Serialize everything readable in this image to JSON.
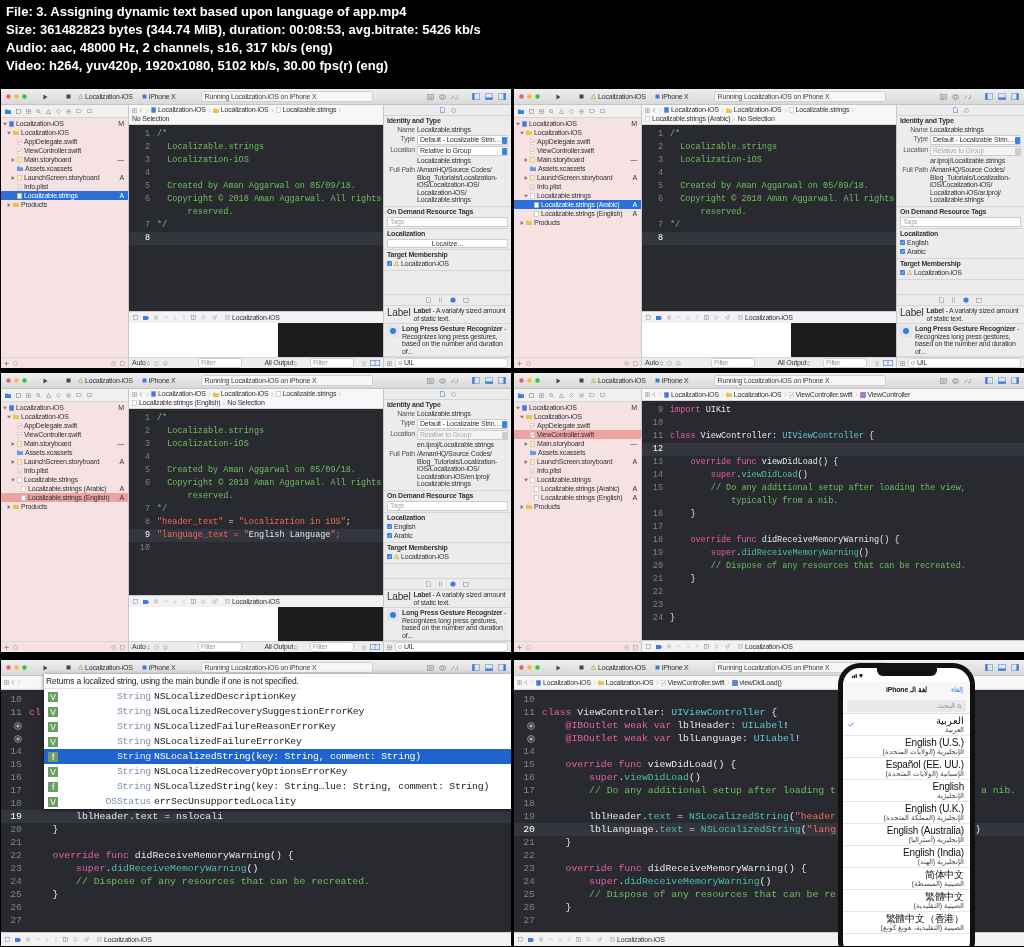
{
  "header": {
    "lines": [
      "File: 3. Assigning dynamic text based upon language of app.mp4",
      "Size: 361482823 bytes (344.74 MiB), duration: 00:08:53, avg.bitrate: 5426 kb/s",
      "Audio: aac, 48000 Hz, 2 channels, s16, 317 kb/s (eng)",
      "Video: h264, yuv420p, 1920x1080, 5102 kb/s, 30.00 fps(r) (eng)"
    ]
  },
  "frames": [
    {
      "kind": "ide",
      "toolbar": {
        "scheme": "Localization-iOS",
        "device": "iPhone X",
        "status": "Running Localization-iOS on iPhone X"
      },
      "navigator": {
        "focused": true,
        "items": [
          {
            "label": "Localization-iOS",
            "kind": "project",
            "badge": "M",
            "selected": false,
            "expanded": true,
            "children": [
              {
                "label": "Localization-iOS",
                "kind": "folder",
                "selected": false,
                "expanded": true,
                "children": [
                  {
                    "label": "AppDelegate.swift",
                    "kind": "swift",
                    "selected": false
                  },
                  {
                    "label": "ViewController.swift",
                    "kind": "swift",
                    "selected": false
                  },
                  {
                    "label": "Main.storyboard",
                    "kind": "storyboard",
                    "badge": "—",
                    "selected": false,
                    "expanded": false
                  },
                  {
                    "label": "Assets.xcassets",
                    "kind": "assets",
                    "selected": false
                  },
                  {
                    "label": "LaunchScreen.storyboard",
                    "kind": "storyboard",
                    "badge": "A",
                    "selected": false,
                    "expanded": false
                  },
                  {
                    "label": "Info.plist",
                    "kind": "plist",
                    "selected": false
                  },
                  {
                    "label": "Localizable.strings",
                    "kind": "strings",
                    "badge": "A",
                    "selected": true
                  }
                ]
              },
              {
                "label": "Products",
                "kind": "folder",
                "selected": false,
                "expanded": false
              }
            ]
          }
        ]
      },
      "breadcrumb": [
        {
          "label": "Localization-iOS",
          "kind": "project"
        },
        {
          "label": "Localization-iOS",
          "kind": "folder"
        },
        {
          "label": "Localizable.strings",
          "kind": "strings"
        },
        {
          "label": "No Selection",
          "kind": "text"
        }
      ],
      "code": [
        {
          "number": "1",
          "tokens": [
            {
              "kind": "comment",
              "text": "/*"
            }
          ]
        },
        {
          "number": "2",
          "tokens": [
            {
              "kind": "comment",
              "text": "  Localizable.strings"
            }
          ]
        },
        {
          "number": "3",
          "tokens": [
            {
              "kind": "comment",
              "text": "  Localization-iOS"
            }
          ]
        },
        {
          "number": "4"
        },
        {
          "number": "5",
          "tokens": [
            {
              "kind": "comment",
              "text": "  Created by Aman Aggarwal on 05/09/18."
            }
          ]
        },
        {
          "number": "6",
          "tokens": [
            {
              "kind": "comment",
              "text": "  Copyright © 2018 Aman Aggarwal. All rights"
            }
          ]
        },
        {
          "tokens": [
            {
              "kind": "comment",
              "text": "      reserved."
            }
          ]
        },
        {
          "number": "7",
          "tokens": [
            {
              "kind": "comment",
              "text": "*/"
            }
          ]
        },
        {
          "number": "8",
          "current": true
        }
      ],
      "debug": {
        "target": "Localization-iOS",
        "console": {
          "mode": "Auto",
          "filter_placeholder": "Filter",
          "output": "All Output",
          "output_filter_placeholder": "Filter"
        }
      },
      "inspector": {
        "identity": {
          "heading": "Identity and Type",
          "rows": [
            {
              "label": "Name",
              "value": "Localizable.strings",
              "kind": "text"
            },
            {
              "label": "Type",
              "value": "Default - Localizable Strin…",
              "kind": "popup",
              "disabled": false
            },
            {
              "label": "Location",
              "value": "Relative to Group",
              "kind": "popup",
              "disabled": false
            }
          ],
          "file": "Localizable.strings",
          "path_label": "Full Path",
          "path": [
            "/AmanHQ/Source Codes/",
            "Blog_Tutorials/Localization-",
            "iOS/Localization-iOS/",
            "Localization-iOS/",
            "Localizable.strings"
          ]
        },
        "tags": {
          "heading": "On Demand Resource Tags",
          "placeholder": "Tags"
        },
        "localization": {
          "heading": "Localization",
          "button": "Localize..."
        },
        "target": {
          "heading": "Target Membership",
          "items": [
            {
              "label": "Localization-iOS",
              "checked": true
            }
          ]
        },
        "library": [
          {
            "kind": "sample",
            "sample": "Label",
            "text": "**Label** - A variably sized amount of static text."
          },
          {
            "kind": "gesture",
            "text": "**Long Press Gesture Recognizer** - Recognizes long press gestures, based on the number and duration of..."
          }
        ],
        "filter": "UIL"
      }
    },
    {
      "kind": "ide",
      "toolbar": {
        "scheme": "Localization-iOS",
        "device": "iPhone X",
        "status": "Running Localization-iOS on iPhone X"
      },
      "navigator": {
        "focused": true,
        "items": [
          {
            "label": "Localization-iOS",
            "kind": "project",
            "badge": "M",
            "selected": false,
            "expanded": true,
            "children": [
              {
                "label": "Localization-iOS",
                "kind": "folder",
                "selected": false,
                "expanded": true,
                "children": [
                  {
                    "label": "AppDelegate.swift",
                    "kind": "swift",
                    "selected": false
                  },
                  {
                    "label": "ViewController.swift",
                    "kind": "swift",
                    "selected": false
                  },
                  {
                    "label": "Main.storyboard",
                    "kind": "storyboard",
                    "badge": "—",
                    "selected": false,
                    "expanded": false
                  },
                  {
                    "label": "Assets.xcassets",
                    "kind": "assets",
                    "selected": false
                  },
                  {
                    "label": "LaunchScreen.storyboard",
                    "kind": "storyboard",
                    "badge": "A",
                    "selected": false,
                    "expanded": false
                  },
                  {
                    "label": "Info.plist",
                    "kind": "plist",
                    "selected": false
                  },
                  {
                    "label": "Localizable.strings",
                    "kind": "strings",
                    "selected": false,
                    "expanded": true,
                    "children": [
                      {
                        "label": "Localizable.strings (Arabic)",
                        "kind": "strings",
                        "badge": "A",
                        "selected": true
                      },
                      {
                        "label": "Localizable.strings (English)",
                        "kind": "strings",
                        "badge": "A",
                        "selected": false
                      }
                    ]
                  }
                ]
              },
              {
                "label": "Products",
                "kind": "folder",
                "selected": false,
                "expanded": false
              }
            ]
          }
        ]
      },
      "breadcrumb": [
        {
          "label": "Localization-iOS",
          "kind": "project"
        },
        {
          "label": "Localization-iOS",
          "kind": "folder"
        },
        {
          "label": "Localizable.strings",
          "kind": "strings"
        },
        {
          "label": "Localizable.strings (Arabic)",
          "kind": "strings"
        },
        {
          "label": "No Selection",
          "kind": "text"
        }
      ],
      "code": [
        {
          "number": "1",
          "tokens": [
            {
              "kind": "comment",
              "text": "/*"
            }
          ]
        },
        {
          "number": "2",
          "tokens": [
            {
              "kind": "comment",
              "text": "  Localizable.strings"
            }
          ]
        },
        {
          "number": "3",
          "tokens": [
            {
              "kind": "comment",
              "text": "  Localization-iOS"
            }
          ]
        },
        {
          "number": "4"
        },
        {
          "number": "5",
          "tokens": [
            {
              "kind": "comment",
              "text": "  Created by Aman Aggarwal on 05/09/18."
            }
          ]
        },
        {
          "number": "6",
          "tokens": [
            {
              "kind": "comment",
              "text": "  Copyright © 2018 Aman Aggarwal. All rights"
            }
          ]
        },
        {
          "tokens": [
            {
              "kind": "comment",
              "text": "      reserved."
            }
          ]
        },
        {
          "number": "7",
          "tokens": [
            {
              "kind": "comment",
              "text": "*/"
            }
          ]
        },
        {
          "number": "8",
          "current": true
        }
      ],
      "debug": {
        "target": "Localization-iOS",
        "console": {
          "mode": "Auto",
          "filter_placeholder": "Filter",
          "output": "All Output",
          "output_filter_placeholder": "Filter"
        }
      },
      "inspector": {
        "identity": {
          "heading": "Identity and Type",
          "rows": [
            {
              "label": "Name",
              "value": "Localizable.strings",
              "kind": "text"
            },
            {
              "label": "Type",
              "value": "Default - Localizable Strin…",
              "kind": "popup",
              "disabled": false
            },
            {
              "label": "Location",
              "value": "Relative to Group",
              "kind": "popup",
              "disabled": true
            }
          ],
          "file": "ar.lproj/Localizable.strings",
          "path_label": "Full Path",
          "path": [
            "/AmanHQ/Source Codes/",
            "Blog_Tutorials/Localization-",
            "iOS/Localization-iOS/",
            "Localization-iOS/ar.lproj/",
            "Localizable.strings"
          ]
        },
        "tags": {
          "heading": "On Demand Resource Tags",
          "placeholder": "Tags"
        },
        "localization": {
          "heading": "Localization",
          "languages": [
            {
              "label": "English",
              "checked": true
            },
            {
              "label": "Arabic",
              "checked": true
            }
          ]
        },
        "target": {
          "heading": "Target Membership",
          "items": [
            {
              "label": "Localization-iOS",
              "checked": true
            }
          ]
        },
        "library": [
          {
            "kind": "sample",
            "sample": "Label",
            "text": "**Label** - A variably sized amount of static text."
          },
          {
            "kind": "gesture",
            "text": "**Long Press Gesture Recognizer** - Recognizes long press gestures, based on the number and duration of..."
          }
        ],
        "filter": "UIL"
      }
    },
    {
      "kind": "ide",
      "toolbar": {
        "scheme": "Localization-iOS",
        "device": "iPhone X",
        "status": "Running Localization-iOS on iPhone X"
      },
      "navigator": {
        "focused": false,
        "items": [
          {
            "label": "Localization-iOS",
            "kind": "project",
            "badge": "M",
            "selected": false,
            "expanded": true,
            "children": [
              {
                "label": "Localization-iOS",
                "kind": "folder",
                "selected": false,
                "expanded": true,
                "children": [
                  {
                    "label": "AppDelegate.swift",
                    "kind": "swift",
                    "selected": false
                  },
                  {
                    "label": "ViewController.swift",
                    "kind": "swift",
                    "selected": false
                  },
                  {
                    "label": "Main.storyboard",
                    "kind": "storyboard",
                    "badge": "—",
                    "selected": false,
                    "expanded": false
                  },
                  {
                    "label": "Assets.xcassets",
                    "kind": "assets",
                    "selected": false
                  },
                  {
                    "label": "LaunchScreen.storyboard",
                    "kind": "storyboard",
                    "badge": "A",
                    "selected": false,
                    "expanded": false
                  },
                  {
                    "label": "Info.plist",
                    "kind": "plist",
                    "selected": false
                  },
                  {
                    "label": "Localizable.strings",
                    "kind": "strings",
                    "selected": false,
                    "expanded": true,
                    "children": [
                      {
                        "label": "Localizable.strings (Arabic)",
                        "kind": "strings",
                        "badge": "A",
                        "selected": false
                      },
                      {
                        "label": "Localizable.strings (English)",
                        "kind": "strings",
                        "badge": "A",
                        "selected": true
                      }
                    ]
                  }
                ]
              },
              {
                "label": "Products",
                "kind": "folder",
                "selected": false,
                "expanded": false
              }
            ]
          }
        ]
      },
      "breadcrumb": [
        {
          "label": "Localization-iOS",
          "kind": "project"
        },
        {
          "label": "Localization-iOS",
          "kind": "folder"
        },
        {
          "label": "Localizable.strings",
          "kind": "strings"
        },
        {
          "label": "Localizable.strings (English)",
          "kind": "strings"
        },
        {
          "label": "No Selection",
          "kind": "text"
        }
      ],
      "code": [
        {
          "number": "1",
          "tokens": [
            {
              "kind": "comment",
              "text": "/*"
            }
          ]
        },
        {
          "number": "2",
          "tokens": [
            {
              "kind": "comment",
              "text": "  Localizable.strings"
            }
          ]
        },
        {
          "number": "3",
          "tokens": [
            {
              "kind": "comment",
              "text": "  Localization-iOS"
            }
          ]
        },
        {
          "number": "4"
        },
        {
          "number": "5",
          "tokens": [
            {
              "kind": "comment",
              "text": "  Created by Aman Aggarwal on 05/09/18."
            }
          ]
        },
        {
          "number": "6",
          "tokens": [
            {
              "kind": "comment",
              "text": "  Copyright © 2018 Aman Aggarwal. All rights"
            }
          ]
        },
        {
          "tokens": [
            {
              "kind": "comment",
              "text": "      reserved."
            }
          ]
        },
        {
          "number": "7",
          "tokens": [
            {
              "kind": "comment",
              "text": "*/"
            }
          ]
        },
        {
          "number": "8",
          "tokens": [
            {
              "kind": "string",
              "text": "\"header_text\""
            },
            {
              "kind": "plain",
              "text": " = "
            },
            {
              "kind": "string",
              "text": "\"Localization in iOS\""
            },
            {
              "kind": "plain",
              "text": ";"
            }
          ]
        },
        {
          "number": "9",
          "tokens": [
            {
              "kind": "string",
              "text": "\"language_text = \""
            },
            {
              "kind": "plain",
              "text": "English Language"
            },
            {
              "kind": "string",
              "text": "\";"
            }
          ],
          "current": true
        },
        {
          "number": "10"
        }
      ],
      "debug": {
        "target": "Localization-iOS",
        "console": {
          "mode": "Auto",
          "filter_placeholder": "Filter",
          "output": "All Output",
          "output_filter_placeholder": "Filter"
        }
      },
      "inspector": {
        "identity": {
          "heading": "Identity and Type",
          "rows": [
            {
              "label": "Name",
              "value": "Localizable.strings",
              "kind": "text"
            },
            {
              "label": "Type",
              "value": "Default - Localizable Strin…",
              "kind": "popup",
              "disabled": false
            },
            {
              "label": "Location",
              "value": "Relative to Group",
              "kind": "popup",
              "disabled": true
            }
          ],
          "file": "en.lproj/Localizable.strings",
          "path_label": "Full Path",
          "path": [
            "/AmanHQ/Source Codes/",
            "Blog_Tutorials/Localization-",
            "iOS/Localization-iOS/",
            "Localization-iOS/en.lproj/",
            "Localizable.strings"
          ]
        },
        "tags": {
          "heading": "On Demand Resource Tags",
          "placeholder": "Tags"
        },
        "localization": {
          "heading": "Localization",
          "languages": [
            {
              "label": "English",
              "checked": true
            },
            {
              "label": "Arabic",
              "checked": true
            }
          ]
        },
        "target": {
          "heading": "Target Membership",
          "items": [
            {
              "label": "Localization-iOS",
              "checked": true
            }
          ]
        },
        "library": [
          {
            "kind": "sample",
            "sample": "Label",
            "text": "**Label** - A variably sized amount of static text."
          },
          {
            "kind": "gesture",
            "text": "**Long Press Gesture Recognizer** - Recognizes long press gestures, based on the number and duration of..."
          }
        ],
        "filter": "UIL"
      }
    },
    {
      "kind": "ide",
      "toolbar": {
        "scheme": "Localization-iOS",
        "device": "iPhone X",
        "status": "Running Localization-iOS on iPhone X"
      },
      "navigator": {
        "focused": false,
        "items": [
          {
            "label": "Localization-iOS",
            "kind": "project",
            "badge": "M",
            "selected": false,
            "expanded": true,
            "children": [
              {
                "label": "Localization-iOS",
                "kind": "folder",
                "selected": false,
                "expanded": true,
                "children": [
                  {
                    "label": "AppDelegate.swift",
                    "kind": "swift",
                    "selected": false
                  },
                  {
                    "label": "ViewController.swift",
                    "kind": "swift",
                    "selected": true
                  },
                  {
                    "label": "Main.storyboard",
                    "kind": "storyboard",
                    "badge": "—",
                    "selected": false,
                    "expanded": false
                  },
                  {
                    "label": "Assets.xcassets",
                    "kind": "assets",
                    "selected": false
                  },
                  {
                    "label": "LaunchScreen.storyboard",
                    "kind": "storyboard",
                    "badge": "A",
                    "selected": false,
                    "expanded": false
                  },
                  {
                    "label": "Info.plist",
                    "kind": "plist",
                    "selected": false
                  },
                  {
                    "label": "Localizable.strings",
                    "kind": "strings",
                    "selected": false,
                    "expanded": true,
                    "children": [
                      {
                        "label": "Localizable.strings (Arabic)",
                        "kind": "strings",
                        "badge": "A",
                        "selected": false
                      },
                      {
                        "label": "Localizable.strings (English)",
                        "kind": "strings",
                        "badge": "A",
                        "selected": false
                      }
                    ]
                  }
                ]
              },
              {
                "label": "Products",
                "kind": "folder",
                "selected": false,
                "expanded": false
              }
            ]
          }
        ]
      },
      "breadcrumb": [
        {
          "label": "Localization-iOS",
          "kind": "project"
        },
        {
          "label": "Localization-iOS",
          "kind": "folder"
        },
        {
          "label": "ViewController.swift",
          "kind": "swift"
        },
        {
          "label": "ViewController",
          "kind": "class"
        }
      ],
      "code": [
        {
          "number": "9",
          "tokens": [
            {
              "kind": "keyword",
              "text": "import"
            },
            {
              "kind": "plain",
              "text": " UIKit"
            }
          ]
        },
        {
          "number": "10"
        },
        {
          "number": "11",
          "tokens": [
            {
              "kind": "keyword",
              "text": "class"
            },
            {
              "kind": "plain",
              "text": " ViewController: "
            },
            {
              "kind": "type",
              "text": "UIViewController"
            },
            {
              "kind": "plain",
              "text": " {"
            }
          ]
        },
        {
          "number": "12",
          "current": true
        },
        {
          "number": "13",
          "tokens": [
            {
              "kind": "keyword",
              "text": "    override func"
            },
            {
              "kind": "plain",
              "text": " viewDidLoad() {"
            }
          ]
        },
        {
          "number": "14",
          "tokens": [
            {
              "kind": "keyword",
              "text": "        super"
            },
            {
              "kind": "plain",
              "text": "."
            },
            {
              "kind": "call",
              "text": "viewDidLoad"
            },
            {
              "kind": "plain",
              "text": "()"
            }
          ]
        },
        {
          "number": "15",
          "tokens": [
            {
              "kind": "comment",
              "text": "        // Do any additional setup after loading the view,"
            }
          ]
        },
        {
          "tokens": [
            {
              "kind": "comment",
              "text": "            typically from a nib."
            }
          ]
        },
        {
          "number": "16",
          "tokens": [
            {
              "kind": "plain",
              "text": "    }"
            }
          ]
        },
        {
          "number": "17"
        },
        {
          "number": "18",
          "tokens": [
            {
              "kind": "keyword",
              "text": "    override func"
            },
            {
              "kind": "plain",
              "text": " didReceiveMemoryWarning() {"
            }
          ]
        },
        {
          "number": "19",
          "tokens": [
            {
              "kind": "keyword",
              "text": "        super"
            },
            {
              "kind": "plain",
              "text": "."
            },
            {
              "kind": "call",
              "text": "didReceiveMemoryWarning"
            },
            {
              "kind": "plain",
              "text": "()"
            }
          ]
        },
        {
          "number": "20",
          "tokens": [
            {
              "kind": "comment",
              "text": "        // Dispose of any resources that can be recreated."
            }
          ]
        },
        {
          "number": "21",
          "tokens": [
            {
              "kind": "plain",
              "text": "    }"
            }
          ]
        },
        {
          "number": "22"
        },
        {
          "number": "23"
        },
        {
          "number": "24",
          "tokens": [
            {
              "kind": "plain",
              "text": "}"
            }
          ]
        }
      ],
      "debug": {
        "target": "Localization-iOS"
      }
    },
    {
      "kind": "zoomed",
      "toolbar": {
        "scheme": "Localization-iOS",
        "device": "iPhone X",
        "status": "Running Localization-iOS on iPhone X"
      },
      "code": [
        {
          "number": "10"
        },
        {
          "number": "11",
          "tokens": [
            {
              "kind": "keyword",
              "text": "cl"
            }
          ]
        },
        {
          "kind": "outlet"
        },
        {
          "kind": "outlet"
        },
        {
          "number": "14"
        },
        {
          "number": "15"
        },
        {
          "number": "16"
        },
        {
          "number": "17"
        },
        {
          "number": "18"
        },
        {
          "number": "19",
          "tokens": [
            {
              "kind": "plain",
              "text": "        lblHeader.text = nslocali"
            }
          ],
          "current": true
        },
        {
          "number": "20",
          "tokens": [
            {
              "kind": "plain",
              "text": "    }"
            }
          ]
        },
        {
          "number": "21"
        },
        {
          "number": "22",
          "tokens": [
            {
              "kind": "keyword",
              "text": "    override func"
            },
            {
              "kind": "plain",
              "text": " didReceiveMemoryWarning() {"
            }
          ]
        },
        {
          "number": "23",
          "tokens": [
            {
              "kind": "keyword",
              "text": "        super"
            },
            {
              "kind": "plain",
              "text": "."
            },
            {
              "kind": "call",
              "text": "didReceiveMemoryWarning"
            },
            {
              "kind": "plain",
              "text": "()"
            }
          ]
        },
        {
          "number": "24",
          "tokens": [
            {
              "kind": "comment",
              "text": "        // Dispose of any resources that can be recreated."
            }
          ]
        },
        {
          "number": "25",
          "tokens": [
            {
              "kind": "plain",
              "text": "    }"
            }
          ]
        },
        {
          "number": "26"
        },
        {
          "number": "27"
        }
      ],
      "debug": {
        "target": "Localization-iOS"
      },
      "popup": {
        "description": "Returns a localized string, using the main bundle if one is not specified.",
        "items": [
          {
            "badge": "V",
            "type": "String",
            "name": "NSLocalizedDescriptionKey",
            "selected": false
          },
          {
            "badge": "V",
            "type": "String",
            "name": "NSLocalizedRecoverySuggestionErrorKey",
            "selected": false
          },
          {
            "badge": "V",
            "type": "String",
            "name": "NSLocalizedFailureReasonErrorKey",
            "selected": false
          },
          {
            "badge": "V",
            "type": "String",
            "name": "NSLocalizedFailureErrorKey",
            "selected": false
          },
          {
            "badge": "f",
            "type": "String",
            "name": "NSLocalizedString(key: String, comment: String)",
            "selected": true
          },
          {
            "badge": "V",
            "type": "String",
            "name": "NSLocalizedRecoveryOptionsErrorKey",
            "selected": false
          },
          {
            "badge": "f",
            "type": "String",
            "name": "NSLocalizedString(key: String…lue: String, comment: String)",
            "selected": false
          },
          {
            "badge": "V",
            "type": "OSStatus",
            "name": "errSecUnsupportedLocality",
            "selected": false
          }
        ]
      }
    },
    {
      "kind": "zoomed",
      "toolbar": {
        "scheme": "Localization-iOS",
        "device": "iPhone X",
        "status": "Running Localization-iOS on iPhone X"
      },
      "breadcrumb": [
        {
          "label": "Localization-iOS",
          "kind": "project"
        },
        {
          "label": "Localization-iOS",
          "kind": "folder"
        },
        {
          "label": "ViewController.swift",
          "kind": "swift"
        },
        {
          "label": "viewDidLoad()",
          "kind": "method"
        }
      ],
      "code": [
        {
          "number": "10"
        },
        {
          "number": "11",
          "tokens": [
            {
              "kind": "keyword",
              "text": "class"
            },
            {
              "kind": "plain",
              "text": " ViewController: "
            },
            {
              "kind": "type",
              "text": "UIViewController"
            },
            {
              "kind": "plain",
              "text": " {"
            }
          ]
        },
        {
          "kind": "outlet",
          "tokens": [
            {
              "kind": "keyword",
              "text": "    @IBOutlet weak var"
            },
            {
              "kind": "plain",
              "text": " lblHeader: "
            },
            {
              "kind": "type",
              "text": "UILabel"
            },
            {
              "kind": "plain",
              "text": "!"
            }
          ]
        },
        {
          "kind": "outlet",
          "tokens": [
            {
              "kind": "keyword",
              "text": "    @IBOutlet weak var"
            },
            {
              "kind": "plain",
              "text": " lblLanguage: "
            },
            {
              "kind": "type",
              "text": "UILabel"
            },
            {
              "kind": "plain",
              "text": "!"
            }
          ]
        },
        {
          "number": "14"
        },
        {
          "number": "15",
          "tokens": [
            {
              "kind": "keyword",
              "text": "    override func"
            },
            {
              "kind": "plain",
              "text": " viewDidLoad() {"
            }
          ]
        },
        {
          "number": "16",
          "tokens": [
            {
              "kind": "keyword",
              "text": "        super"
            },
            {
              "kind": "plain",
              "text": "."
            },
            {
              "kind": "call",
              "text": "viewDidLoad"
            },
            {
              "kind": "plain",
              "text": "()"
            }
          ]
        },
        {
          "number": "17",
          "tokens": [
            {
              "kind": "comment",
              "text": "        // Do any additional setup after loading t"
            }
          ],
          "tail": [
            {
              "kind": "comment",
              "text": " a nib."
            }
          ]
        },
        {
          "number": "18"
        },
        {
          "number": "19",
          "tokens": [
            {
              "kind": "plain",
              "text": "        lblHeader."
            },
            {
              "kind": "call",
              "text": "text"
            },
            {
              "kind": "plain",
              "text": " = "
            },
            {
              "kind": "call",
              "text": "NSLocalizedString"
            },
            {
              "kind": "plain",
              "text": "("
            },
            {
              "kind": "string",
              "text": "\"header"
            }
          ]
        },
        {
          "number": "20",
          "tokens": [
            {
              "kind": "plain",
              "text": "        lblLanguage."
            },
            {
              "kind": "call",
              "text": "text"
            },
            {
              "kind": "plain",
              "text": " = "
            },
            {
              "kind": "call",
              "text": "NSLocalizedString"
            },
            {
              "kind": "plain",
              "text": "("
            },
            {
              "kind": "string",
              "text": "\"lang"
            }
          ],
          "tail": [
            {
              "kind": "plain",
              "text": ")"
            }
          ],
          "current": true
        },
        {
          "number": "21",
          "tokens": [
            {
              "kind": "plain",
              "text": "    }"
            }
          ]
        },
        {
          "number": "22"
        },
        {
          "number": "23",
          "tokens": [
            {
              "kind": "keyword",
              "text": "    override func"
            },
            {
              "kind": "plain",
              "text": " didReceiveMemoryWarning() {"
            }
          ]
        },
        {
          "number": "24",
          "tokens": [
            {
              "kind": "keyword",
              "text": "        super"
            },
            {
              "kind": "plain",
              "text": "."
            },
            {
              "kind": "call",
              "text": "didReceiveMemoryWarning"
            },
            {
              "kind": "plain",
              "text": "()"
            }
          ]
        },
        {
          "number": "25",
          "tokens": [
            {
              "kind": "comment",
              "text": "        // Dispose of any resources that can be re"
            }
          ]
        },
        {
          "number": "26",
          "tokens": [
            {
              "kind": "plain",
              "text": "    }"
            }
          ]
        },
        {
          "number": "27"
        }
      ],
      "debug": {
        "target": "Localization-iOS"
      },
      "phone": {
        "title": "لغة الـ iPhone",
        "cancel": "إلغاء",
        "search_placeholder": "البحث",
        "languages": [
          {
            "name": "العربية",
            "native": "العربية",
            "selected": true
          },
          {
            "name": "English (U.S.)",
            "native": "الإنجليزية (الولايات المتحدة)",
            "selected": false
          },
          {
            "name": "Español (EE. UU.)",
            "native": "الإسبانية (الولايات المتحدة)",
            "selected": false
          },
          {
            "name": "English",
            "native": "الإنجليزية",
            "selected": false
          },
          {
            "name": "English (U.K.)",
            "native": "الإنجليزية (المملكة المتحدة)",
            "selected": false
          },
          {
            "name": "English (Australia)",
            "native": "الإنجليزية (أستراليا)",
            "selected": false
          },
          {
            "name": "English (India)",
            "native": "الإنجليزية (الهند)",
            "selected": false
          },
          {
            "name": "简体中文",
            "native": "الصينية (المبسطة)",
            "selected": false
          },
          {
            "name": "繁體中文",
            "native": "الصينية (التقليدية)",
            "selected": false
          },
          {
            "name": "繁體中文（香港）",
            "native": "الصينية (التقليدية، هونغ كونغ)",
            "selected": false
          }
        ]
      }
    }
  ]
}
